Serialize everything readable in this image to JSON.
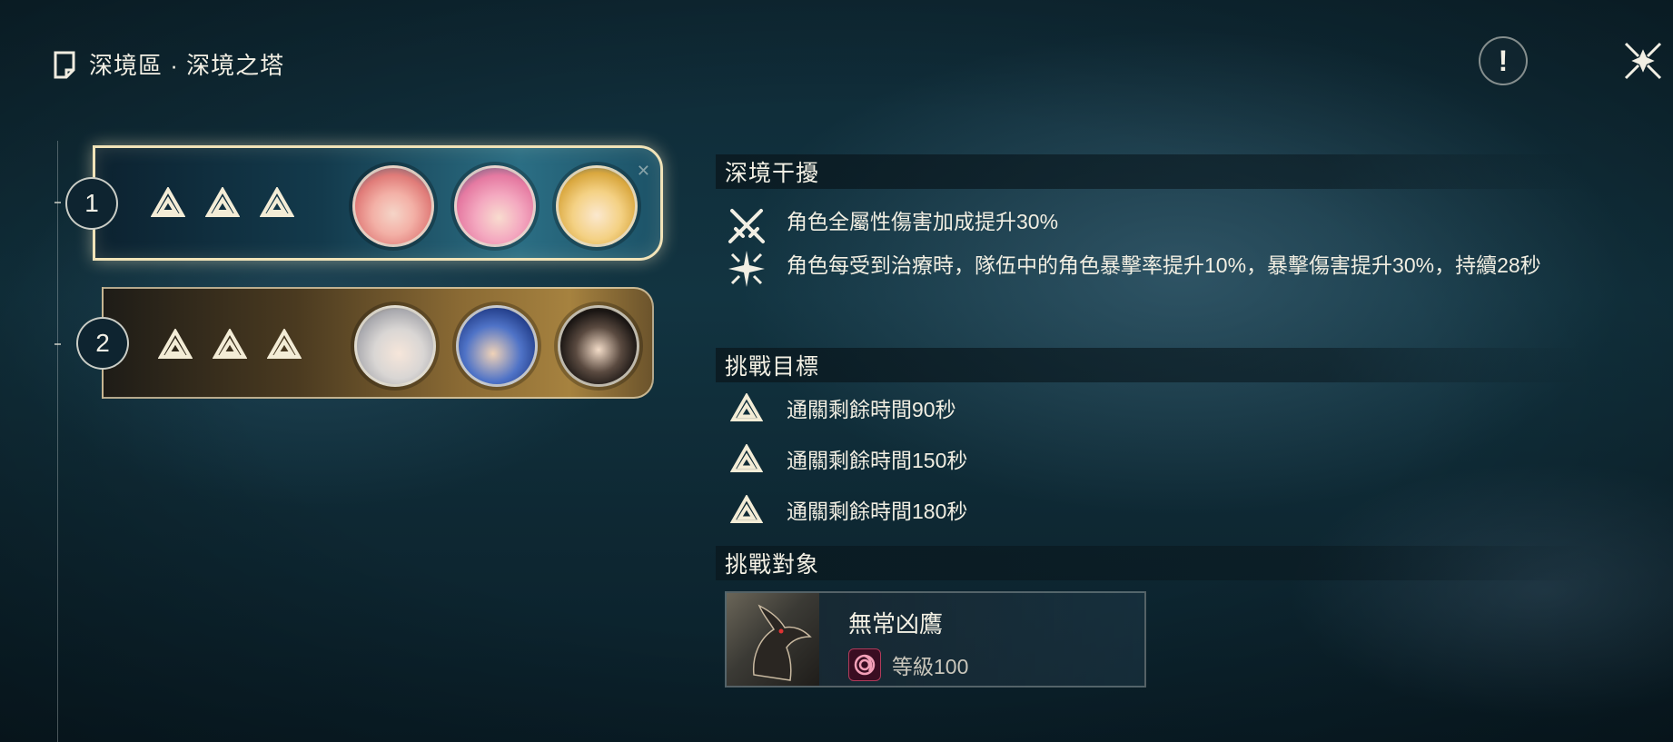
{
  "header": {
    "breadcrumb": "深境區 · 深境之塔"
  },
  "teams": [
    {
      "number": "1",
      "selected": true,
      "rank_stars": 3,
      "avatars": [
        "character-pink-hair",
        "character-pink-bun",
        "character-blonde"
      ]
    },
    {
      "number": "2",
      "selected": false,
      "rank_stars": 3,
      "avatars": [
        "character-white-hair",
        "character-blue-hair",
        "character-black-hair"
      ]
    }
  ],
  "interference": {
    "title": "深境干擾",
    "buffs": [
      {
        "icon": "crossed-swords-icon",
        "text": "角色全屬性傷害加成提升30%"
      },
      {
        "icon": "burst-star-icon",
        "text": "角色每受到治療時，隊伍中的角色暴擊率提升10%，暴擊傷害提升30%，持續28秒"
      }
    ]
  },
  "goals": {
    "title": "挑戰目標",
    "items": [
      {
        "text": "通關剩餘時間90秒"
      },
      {
        "text": "通關剩餘時間150秒"
      },
      {
        "text": "通關剩餘時間180秒"
      }
    ]
  },
  "target": {
    "title": "挑戰對象",
    "name": "無常凶鷹",
    "level": "等級100",
    "element_icon": "havoc-element-icon"
  },
  "colors": {
    "gold_border": "#f1e3b8",
    "text": "#f1eee2",
    "background": "#123441"
  }
}
